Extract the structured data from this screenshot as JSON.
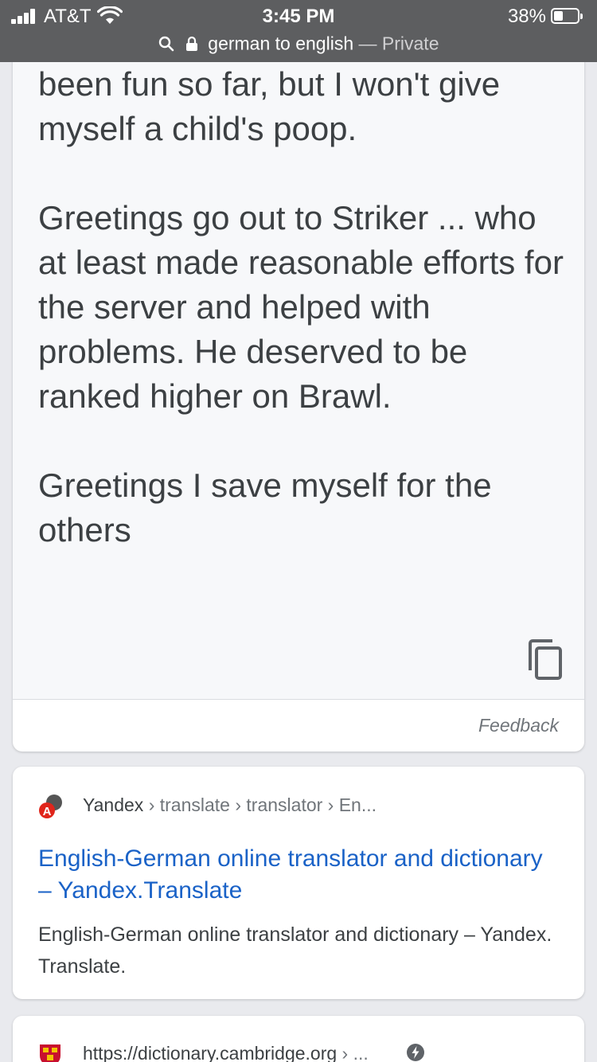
{
  "status_bar": {
    "carrier": "AT&T",
    "time": "3:45 PM",
    "battery_percent": "38%",
    "battery_level": 0.38
  },
  "url_bar": {
    "query": "german to english",
    "separator": " — ",
    "private_label": "Private"
  },
  "translation": {
    "paragraphs": [
      "been fun so far, but I won't give myself a child's poop.",
      "Greetings go out to Striker ... who at least made reasonable efforts for the server and helped with problems. He deserved to be ranked higher on Brawl.",
      "Greetings I save myself for the others"
    ],
    "feedback_label": "Feedback"
  },
  "results": [
    {
      "site": "Yandex",
      "path": " › translate › translator › En...",
      "title": "English-German online translator and dictionary – Yandex.Translate",
      "snippet": "English-German online translator and dictionary – Yandex. Translate."
    },
    {
      "site": "https://dictionary.cambridge.org",
      "path": " › ..."
    }
  ],
  "colors": {
    "top_bar": "#5d5e60",
    "link_blue": "#1a62c7",
    "text_dark": "#3c4043",
    "text_muted": "#70757a",
    "page_bg": "#e9eaee"
  },
  "icons": [
    "signal-icon",
    "wifi-icon",
    "battery-icon",
    "search-icon",
    "lock-icon",
    "copy-icon",
    "yandex-favicon",
    "cambridge-favicon",
    "amp-icon"
  ]
}
